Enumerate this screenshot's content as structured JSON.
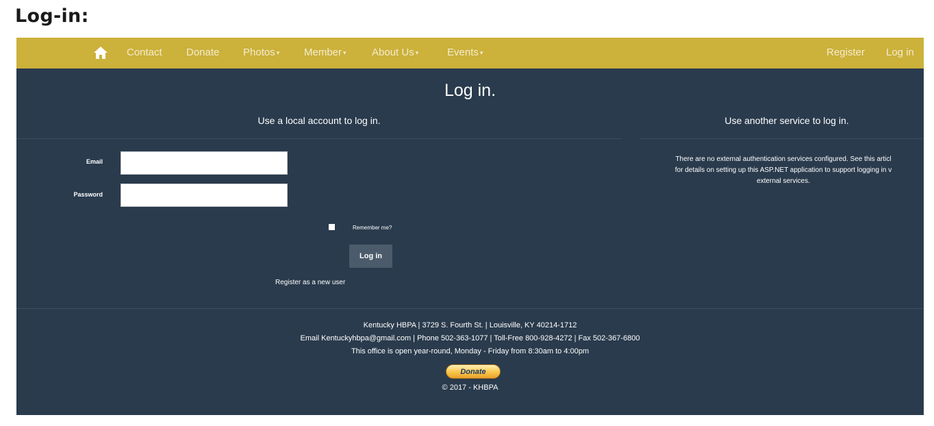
{
  "doc_title": "Log-in:",
  "nav": {
    "home_icon": "home-icon",
    "items": [
      {
        "label": "Contact",
        "caret": ""
      },
      {
        "label": "Donate",
        "caret": ""
      },
      {
        "label": "Photos",
        "caret": "▾"
      },
      {
        "label": "Member",
        "caret": "▾"
      },
      {
        "label": "About Us",
        "caret": "▾"
      },
      {
        "label": "Events",
        "caret": "▾"
      }
    ],
    "right": [
      "Register",
      "Log in"
    ]
  },
  "content": {
    "title": "Log in.",
    "local_heading": "Use a local account to log in.",
    "external_heading": "Use another service to log in.",
    "email_label": "Email",
    "email_value": "",
    "password_label": "Password",
    "password_value": "",
    "remember_label": "Remember me?",
    "login_button": "Log in",
    "register_link": "Register as a new user",
    "external_note": [
      "There are no external authentication services configured. See this articl",
      "for details on setting up this ASP.NET application to support logging in v",
      "external services."
    ]
  },
  "footer": {
    "line1": "Kentucky HBPA | 3729 S. Fourth St. | Louisville, KY 40214-1712",
    "line2": "Email Kentuckyhbpa@gmail.com | Phone 502-363-1077 | Toll-Free 800-928-4272 | Fax 502-367-6800",
    "line3": "This office is open year-round, Monday - Friday from 8:30am to 4:00pm",
    "donate_button": "Donate",
    "copyright": "© 2017 - KHBPA"
  },
  "colors": {
    "navbar": "#ccb13a",
    "background": "#2a3b4d",
    "button": "#4b5b6b"
  }
}
